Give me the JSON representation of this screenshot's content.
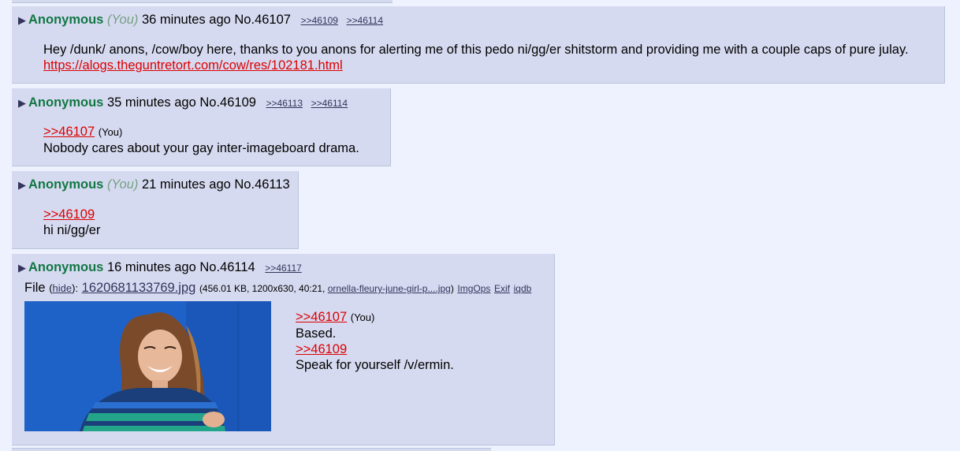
{
  "posts": [
    {
      "name": "Anonymous",
      "you_tag": "(You)",
      "time": "36 minutes ago",
      "number": "No.46107",
      "backlinks": [
        ">>46109",
        ">>46114"
      ],
      "message": "Hey /dunk/ anons, /cow/boy here, thanks to you anons for alerting me of this pedo ni/gg/er shitstorm and providing me with a couple caps of pure julay.",
      "link": "https://alogs.theguntretort.com/cow/res/102181.html"
    },
    {
      "name": "Anonymous",
      "time": "35 minutes ago",
      "number": "No.46109",
      "backlinks": [
        ">>46113",
        ">>46114"
      ],
      "quote": ">>46107",
      "quote_you": "(You)",
      "message": "Nobody cares about your gay inter-imageboard drama."
    },
    {
      "name": "Anonymous",
      "you_tag": "(You)",
      "time": "21 minutes ago",
      "number": "No.46113",
      "quote": ">>46109",
      "message": "hi ni/gg/er"
    },
    {
      "name": "Anonymous",
      "time": "16 minutes ago",
      "number": "No.46114",
      "backlinks": [
        ">>46117"
      ],
      "file": {
        "label": "File",
        "hide": "hide",
        "filename": "1620681133769.jpg",
        "info_open": "(456.01 KB, 1200x630, 40:21, ",
        "original_name": "ornella-fleury-june-girl-p....jpg",
        "info_close": ")",
        "tools": [
          "ImgOps",
          "Exif",
          "iqdb"
        ]
      },
      "quote1": ">>46107",
      "quote1_you": "(You)",
      "line1": "Based.",
      "quote2": ">>46109",
      "line2": "Speak for yourself /v/ermin."
    }
  ]
}
